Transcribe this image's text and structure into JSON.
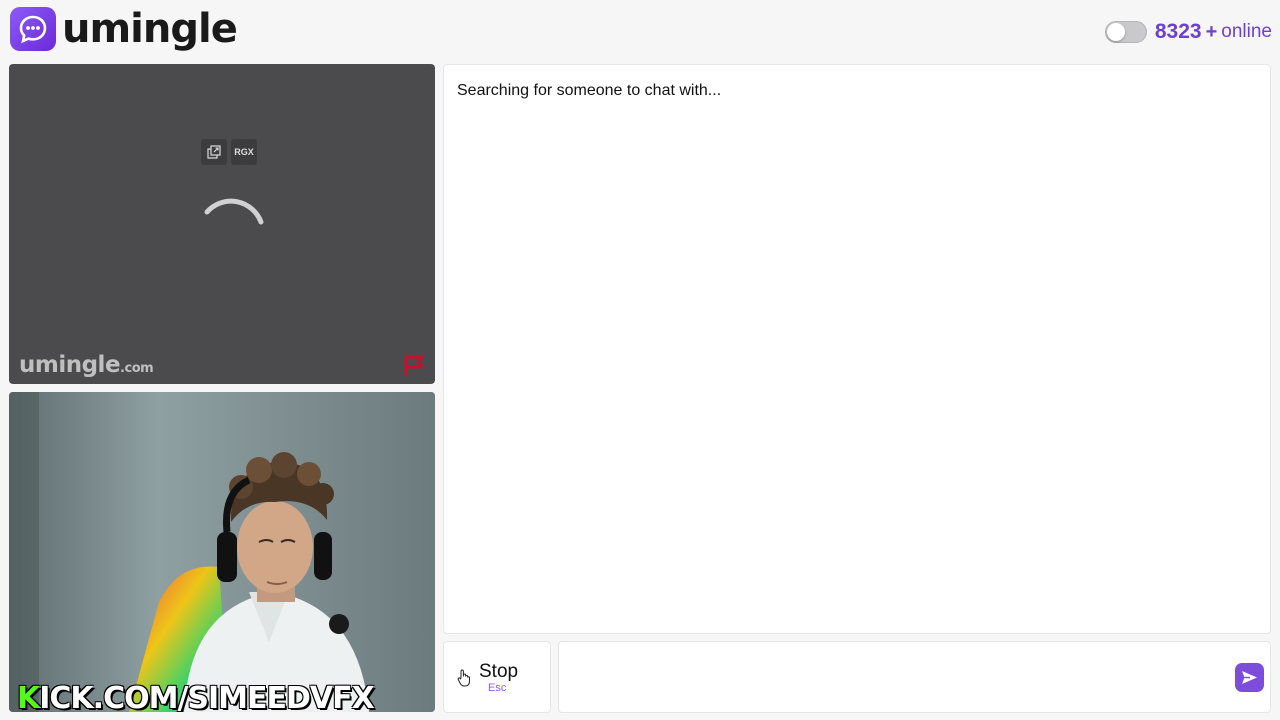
{
  "header": {
    "logo_text": "umingle",
    "online_count": "8323",
    "online_plus": "+",
    "online_label": "online"
  },
  "partner_video": {
    "tools": [
      "popout-icon",
      "RGX"
    ],
    "rgx_label": "RGX",
    "watermark_main": "umingle",
    "watermark_suffix": ".com",
    "report_icon": "flag-icon"
  },
  "self_video": {
    "overlay_k": "K",
    "overlay_rest": "ICK.COM/SIMEEDVFX"
  },
  "chat": {
    "status": "Searching for someone to chat with..."
  },
  "controls": {
    "stop_label": "Stop",
    "stop_key": "Esc",
    "message_placeholder": "",
    "send_icon": "send-icon"
  },
  "colors": {
    "brand": "#7c4ddb",
    "online_text": "#6d3fd3",
    "video_bg": "#4b4b4d",
    "report_flag": "#c8102e",
    "kick_green": "#53fc18"
  }
}
